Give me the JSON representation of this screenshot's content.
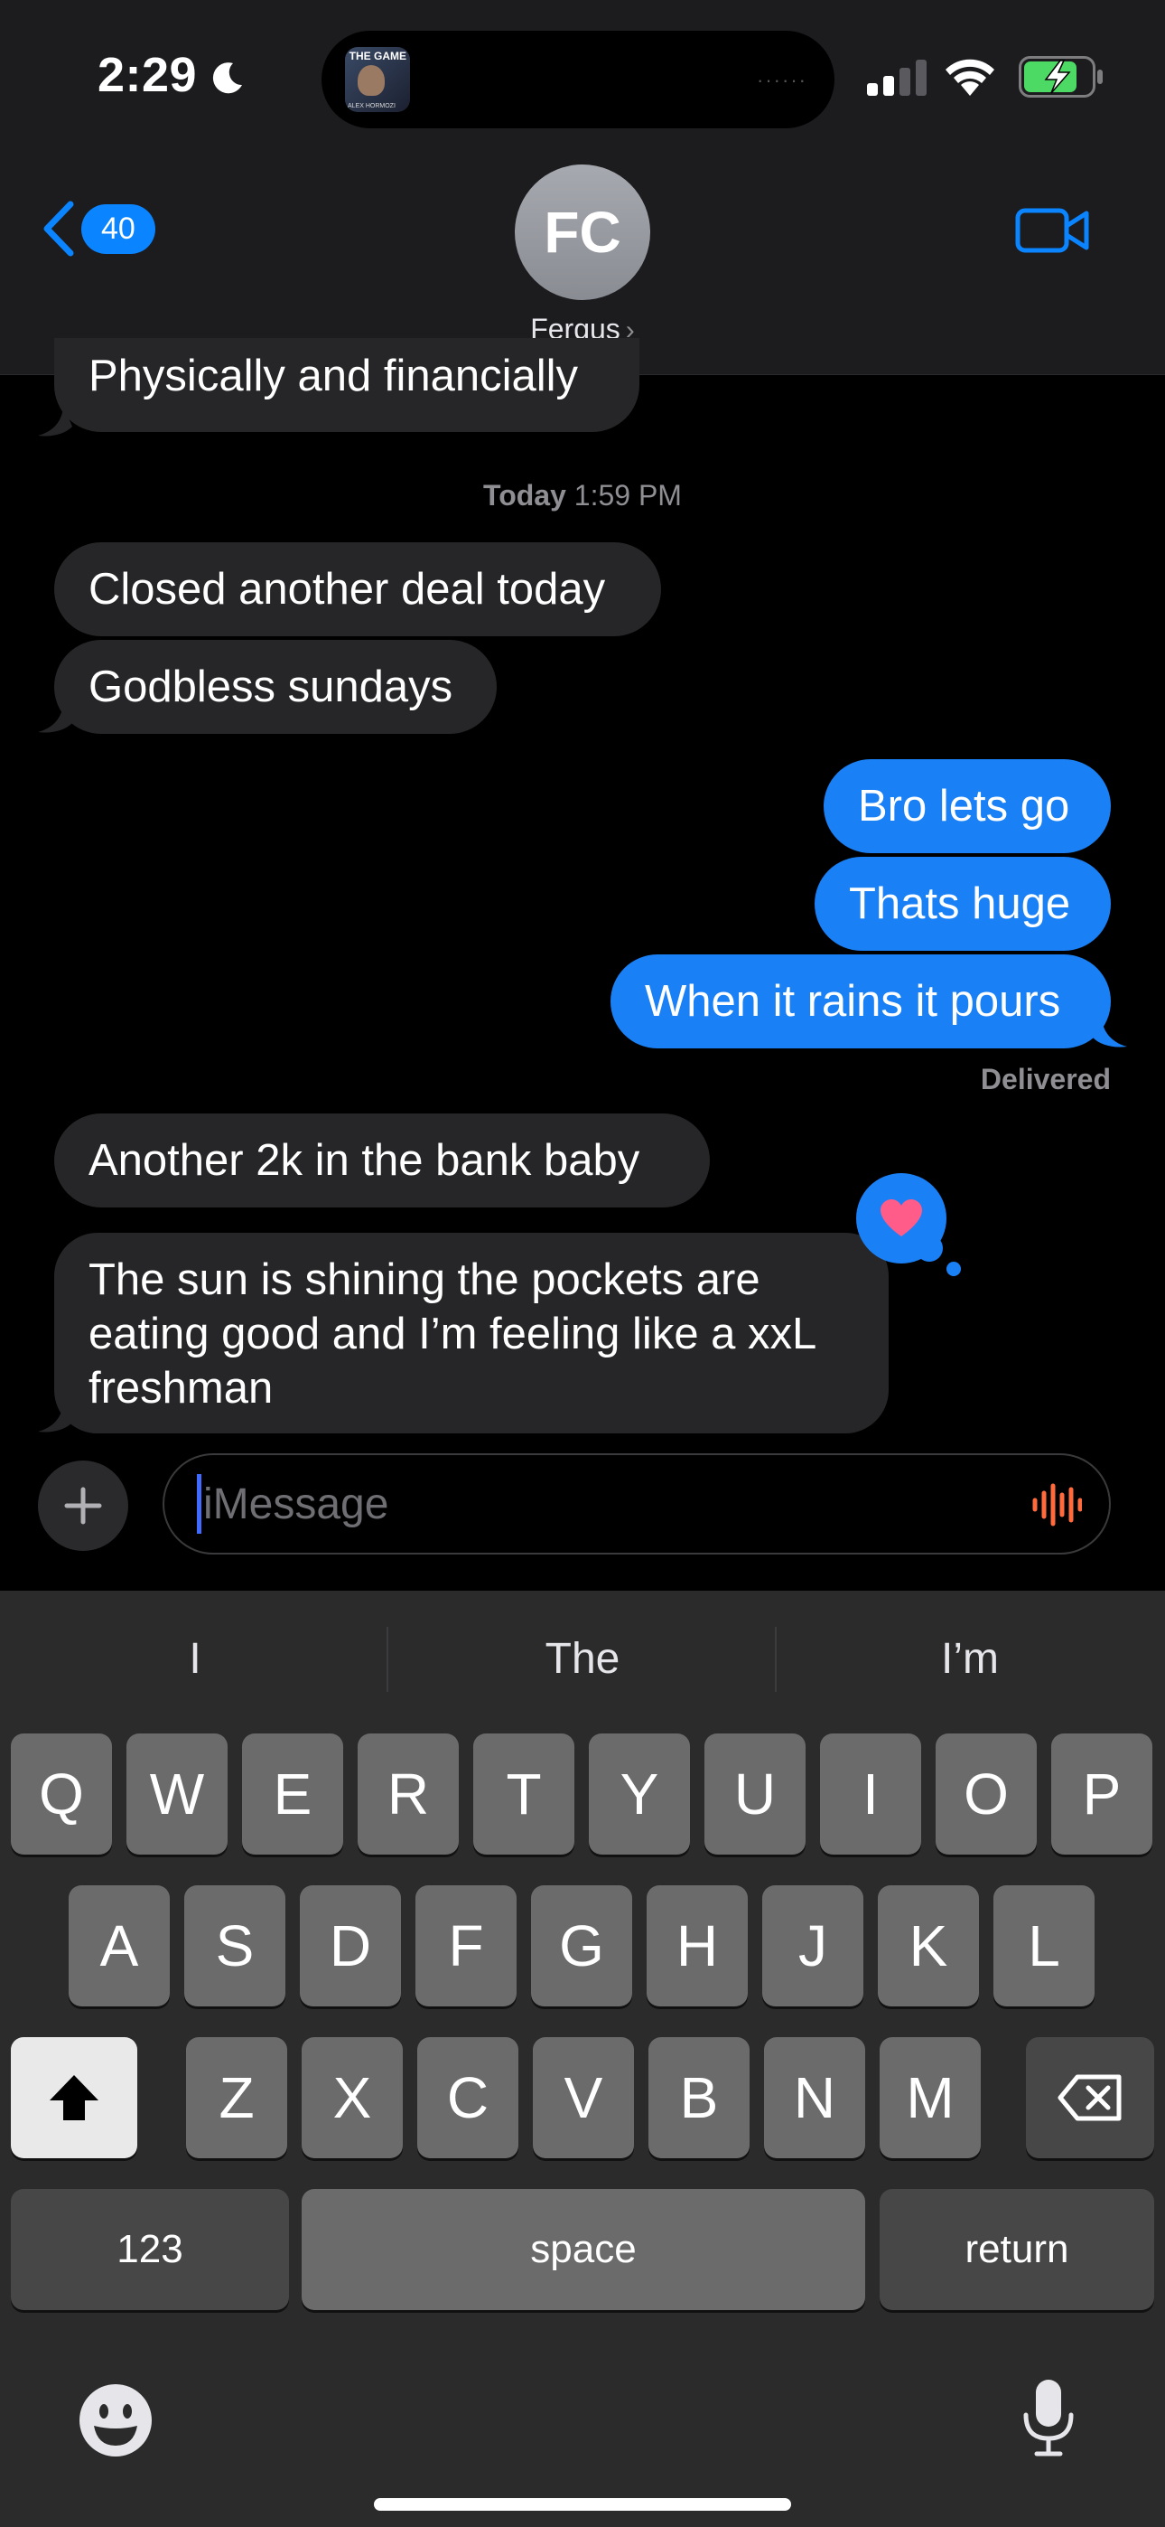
{
  "status_bar": {
    "time": "2:29",
    "island_art_title": "THE GAME",
    "island_art_sub": "ALEX HORMOZI"
  },
  "header": {
    "back_count": "40",
    "avatar_initials": "FC",
    "contact_name": "Fergus"
  },
  "messages": {
    "m0": "Physically and financially",
    "ts_day": "Today",
    "ts_time": "1:59 PM",
    "m1": "Closed another deal today",
    "m2": "Godbless sundays",
    "m3": "Bro lets go",
    "m4": "Thats huge",
    "m5": "When it rains it pours",
    "delivered": "Delivered",
    "m6": "Another 2k in the bank baby",
    "m7": "The sun is shining the pockets are eating good and I’m feeling like a xxL freshman"
  },
  "compose": {
    "placeholder": "iMessage"
  },
  "keyboard": {
    "predictions": [
      "I",
      "The",
      "I’m"
    ],
    "row1": [
      "Q",
      "W",
      "E",
      "R",
      "T",
      "Y",
      "U",
      "I",
      "O",
      "P"
    ],
    "row2": [
      "A",
      "S",
      "D",
      "F",
      "G",
      "H",
      "J",
      "K",
      "L"
    ],
    "row3": [
      "Z",
      "X",
      "C",
      "V",
      "B",
      "N",
      "M"
    ],
    "numbers": "123",
    "space": "space",
    "return": "return"
  },
  "colors": {
    "sent_bubble": "#1a80f5",
    "received_bubble": "#262628",
    "accent": "#0a84ff",
    "heart": "#ff5c8a"
  },
  "icons": [
    "moon-icon",
    "cellular-icon",
    "wifi-icon",
    "battery-charging-icon",
    "back-chevron-icon",
    "video-call-icon",
    "plus-icon",
    "audio-wave-icon",
    "heart-icon",
    "shift-icon",
    "backspace-icon",
    "emoji-icon",
    "microphone-icon"
  ]
}
